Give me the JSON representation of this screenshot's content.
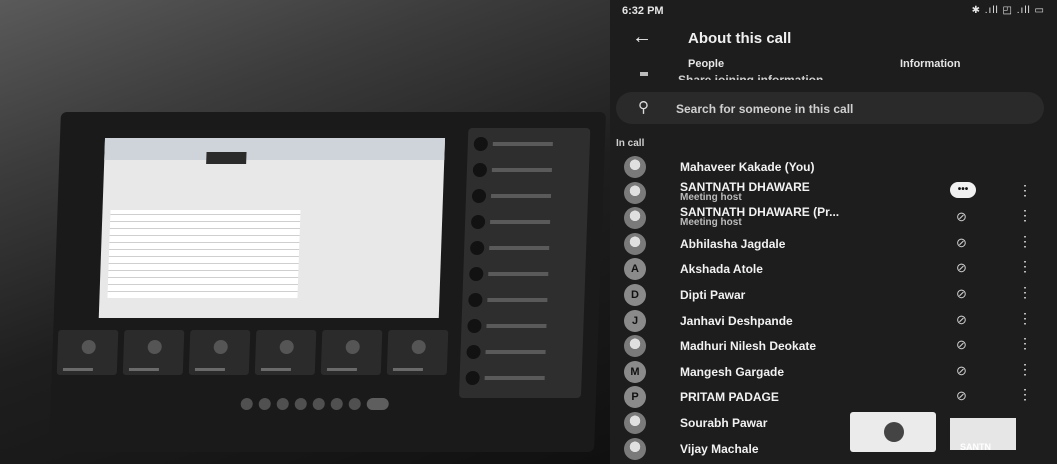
{
  "status_bar": {
    "time": "6:32 PM",
    "icons": "✱ .ıll ◰ .ıll ▭"
  },
  "header": {
    "back_icon": "arrow-left-icon",
    "title": "About this call"
  },
  "tabs": [
    {
      "label": "People"
    },
    {
      "label": "Information"
    }
  ],
  "share_link": "Share joining information",
  "search": {
    "placeholder": "Search for someone in this call"
  },
  "section_label": "In call",
  "participants": [
    {
      "name": "Mahaveer Kakade (You)",
      "role": "",
      "initial": ""
    },
    {
      "name": "SANTNATH DHAWARE",
      "role": "Meeting host",
      "initial": ""
    },
    {
      "name": "SANTNATH DHAWARE (Pr...",
      "role": "Meeting host",
      "initial": ""
    },
    {
      "name": "Abhilasha Jagdale",
      "role": "",
      "initial": ""
    },
    {
      "name": "Akshada Atole",
      "role": "",
      "initial": "A"
    },
    {
      "name": "Dipti Pawar",
      "role": "",
      "initial": "D"
    },
    {
      "name": "Janhavi Deshpande",
      "role": "",
      "initial": "J"
    },
    {
      "name": "Madhuri Nilesh Deokate",
      "role": "",
      "initial": ""
    },
    {
      "name": "Mangesh Gargade",
      "role": "",
      "initial": "M"
    },
    {
      "name": "PRITAM PADAGE",
      "role": "",
      "initial": "P"
    },
    {
      "name": "Sourabh Pawar",
      "role": "",
      "initial": ""
    },
    {
      "name": "Vijay Machale",
      "role": "",
      "initial": ""
    }
  ],
  "pip_label": "SANTN"
}
